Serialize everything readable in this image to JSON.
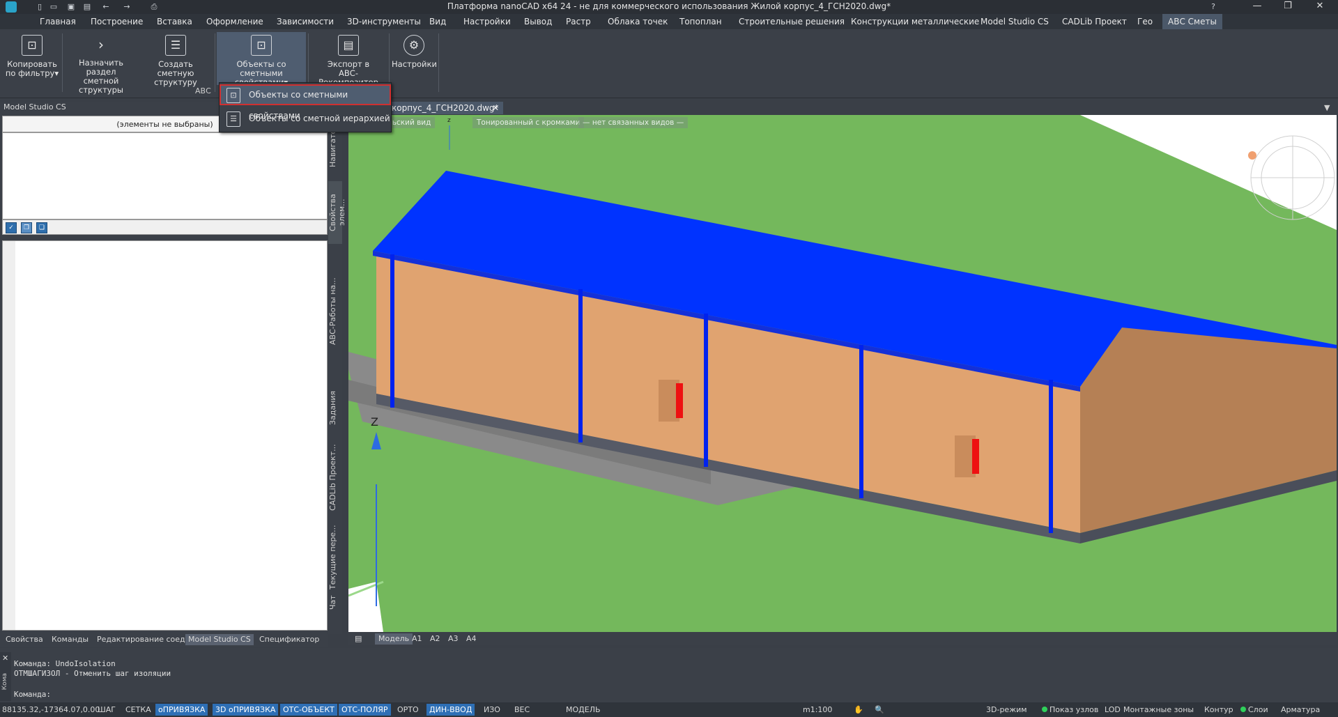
{
  "titlebar": {
    "title": "Платформа nanoCAD x64 24 - не для коммерческого использования Жилой корпус_4_ГСН2020.dwg*",
    "minimize": "—",
    "maximize": "❐",
    "close": "✕"
  },
  "menu_tabs": [
    "Главная",
    "Построение",
    "Вставка",
    "Оформление",
    "Зависимости",
    "3D-инструменты",
    "Вид",
    "Настройки",
    "Вывод",
    "Растр",
    "Облака точек",
    "Топоплан",
    "Строительные решения",
    "Конструкции металлические",
    "Model Studio CS",
    "CADLib Проект",
    "Гео",
    "АВС Сметы"
  ],
  "ribbon": {
    "buttons": [
      {
        "line1": "Копировать",
        "line2": "по фильтру▾",
        "icon": "filter-copy-icon"
      },
      {
        "line1": "Назначить раздел",
        "line2": "сметной структуры",
        "icon": "chevron-right-icon"
      },
      {
        "line1": "Создать",
        "line2": "сметную структуру",
        "icon": "list-icon"
      },
      {
        "line1": "Объекты со сметными",
        "line2": "свойствами▾",
        "icon": "estimate-object-icon"
      },
      {
        "line1": "Экспорт в",
        "line2": "АВС-Рекомпозитор",
        "icon": "export-icon"
      },
      {
        "line1": "Настройки",
        "line2": "",
        "icon": "gear-icon"
      }
    ],
    "panel_caption": "АВС"
  },
  "dropdown": {
    "items": [
      "Объекты со сметными свойствами",
      "Объекты со сметной иерархией"
    ]
  },
  "left_panel": {
    "header": "Model Studio CS",
    "selection_text": "(элементы не выбраны)"
  },
  "vertical_tabs": [
    "Навигатор",
    "Свойства элем...",
    "АВС-Работы на...",
    "Задания",
    "CADLib Проект...",
    "Текущие пере...",
    "Чат"
  ],
  "document_tab": {
    "label": "корпус_4_ГСН2020.dwg*",
    "close": "✕"
  },
  "viewport_toolbar": [
    "льзовательский вид",
    "Тонированный с кромками",
    "— нет связанных видов —"
  ],
  "viewport": {
    "axis_z_label": "Z",
    "small_axis_label": "z"
  },
  "layout_tabs": [
    "Модель",
    "A1",
    "A2",
    "A3",
    "A4"
  ],
  "panel_tabs": [
    "Свойства",
    "Команды",
    "Редактирование соед...",
    "Model Studio CS",
    "Спецификатор"
  ],
  "command": {
    "lines": [
      "Команда: UndoIsolation",
      "ОТМШАГИЗОЛ - Отменить шаг изоляции"
    ],
    "prompt": "Команда:",
    "strip_label": "Кома"
  },
  "statusbar": {
    "coords": "88135.32,-17364.07,0.00",
    "toggles": [
      {
        "label": "ШАГ",
        "on": false
      },
      {
        "label": "СЕТКА",
        "on": false
      },
      {
        "label": "оПРИВЯЗКА",
        "on": true
      },
      {
        "label": "3D оПРИВЯЗКА",
        "on": true
      },
      {
        "label": "ОТС-ОБЪЕКТ",
        "on": true
      },
      {
        "label": "ОТС-ПОЛЯР",
        "on": true
      },
      {
        "label": "ОРТО",
        "on": false
      },
      {
        "label": "ДИН-ВВОД",
        "on": true
      },
      {
        "label": "ИЗО",
        "on": false
      },
      {
        "label": "ВЕС",
        "on": false
      }
    ],
    "mode": "МОДЕЛЬ",
    "scale": "m1:100",
    "right_items": [
      "3D-режим",
      "Показ узлов",
      "LOD",
      "Монтажные зоны",
      "Контур",
      "Слои",
      "Арматура"
    ]
  }
}
